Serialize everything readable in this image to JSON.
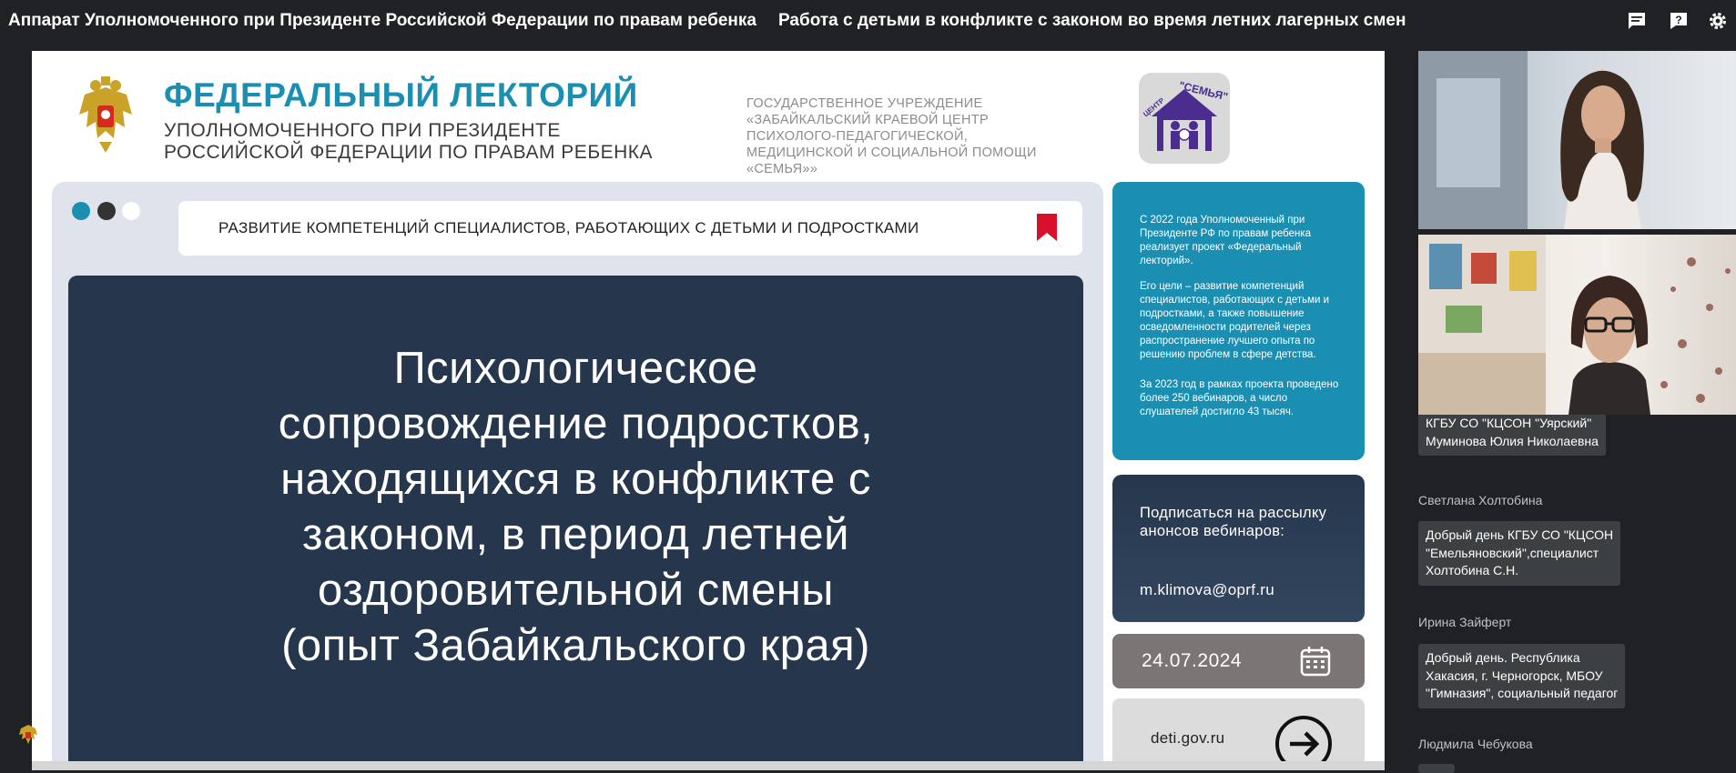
{
  "window": {
    "org_title": "Аппарат Уполномоченного при Президенте Российской Федерации по правам ребенка",
    "session_title": "Работа с детьми в конфликте с законом во время летних лагерных смен"
  },
  "slide": {
    "brand_title": "ФЕДЕРАЛЬНЫЙ ЛЕКТОРИЙ",
    "brand_sub_line1": "УПОЛНОМОЧЕННОГО ПРИ ПРЕЗИДЕНТЕ",
    "brand_sub_line2": "РОССИЙСКОЙ ФЕДЕРАЦИИ ПО ПРАВАМ РЕБЕНКА",
    "org_lines": [
      "Государственное учреждение",
      "«Забайкальский краевой центр",
      "психолого-педагогической,",
      "медицинской и социальной помощи",
      "«Семья»»"
    ],
    "semya_logo_text": "\"СЕМЬЯ\"",
    "semya_logo_side": "ЦЕНТР",
    "banner_text": "РАЗВИТИЕ КОМПЕТЕНЦИЙ СПЕЦИАЛИСТОВ, РАБОТАЮЩИХ С ДЕТЬМИ И ПОДРОСТКАМИ",
    "main_title_lines": [
      "Психологическое",
      "сопровождение подростков,",
      "находящихся в конфликте с",
      "законом, в период летней",
      "оздоровительной смены",
      "(опыт Забайкальского края)"
    ],
    "info_p1": "С 2022 года Уполномоченный при Президенте РФ по правам ребенка реализует проект «Федеральный лекторий».",
    "info_p2": "Его цели – развитие компетенций специалистов, работающих с детьми и подростками, а также повышение осведомленности родителей через распространение лучшего опыта по решению проблем в сфере детства.",
    "info_p3": "За 2023 год в рамках проекта проведено более 250 вебинаров, а число слушателей достигло 43 тысяч.",
    "subscribe_text": "Подписаться на рассылку анонсов вебинаров:",
    "subscribe_email": "m.klimova@oprf.ru",
    "date": "24.07.2024",
    "site": "deti.gov.ru"
  },
  "chat": {
    "messages": [
      {
        "author": "",
        "text_lines": [
          "КГБУ СО \"КЦСОН \"Уярский\"",
          "Муминова Юлия Николаевна"
        ]
      },
      {
        "author": "Светлана Холтобина",
        "text_lines": [
          "Добрый день КГБУ СО \"КЦСОН",
          "\"Емельяновский\",специалист",
          "Холтобина С.Н."
        ]
      },
      {
        "author": "Ирина Зайферт",
        "text_lines": [
          "Добрый день. Республика",
          "Хакасия, г. Черногорск, МБОУ",
          "\"Гимназия\", социальный педагог"
        ]
      },
      {
        "author": "Людмила Чебукова",
        "text_lines": []
      }
    ]
  },
  "icons": {
    "chat": "chat-icon",
    "help": "help-icon",
    "settings": "gear-icon",
    "bookmark": "bookmark-icon",
    "calendar": "calendar-icon",
    "arrow": "arrow-right-circle-icon"
  },
  "colors": {
    "brand_blue": "#1b8fb1",
    "navy": "#26374d",
    "bookmark_red": "#d6102a",
    "semya_purple": "#4a2d8f"
  }
}
